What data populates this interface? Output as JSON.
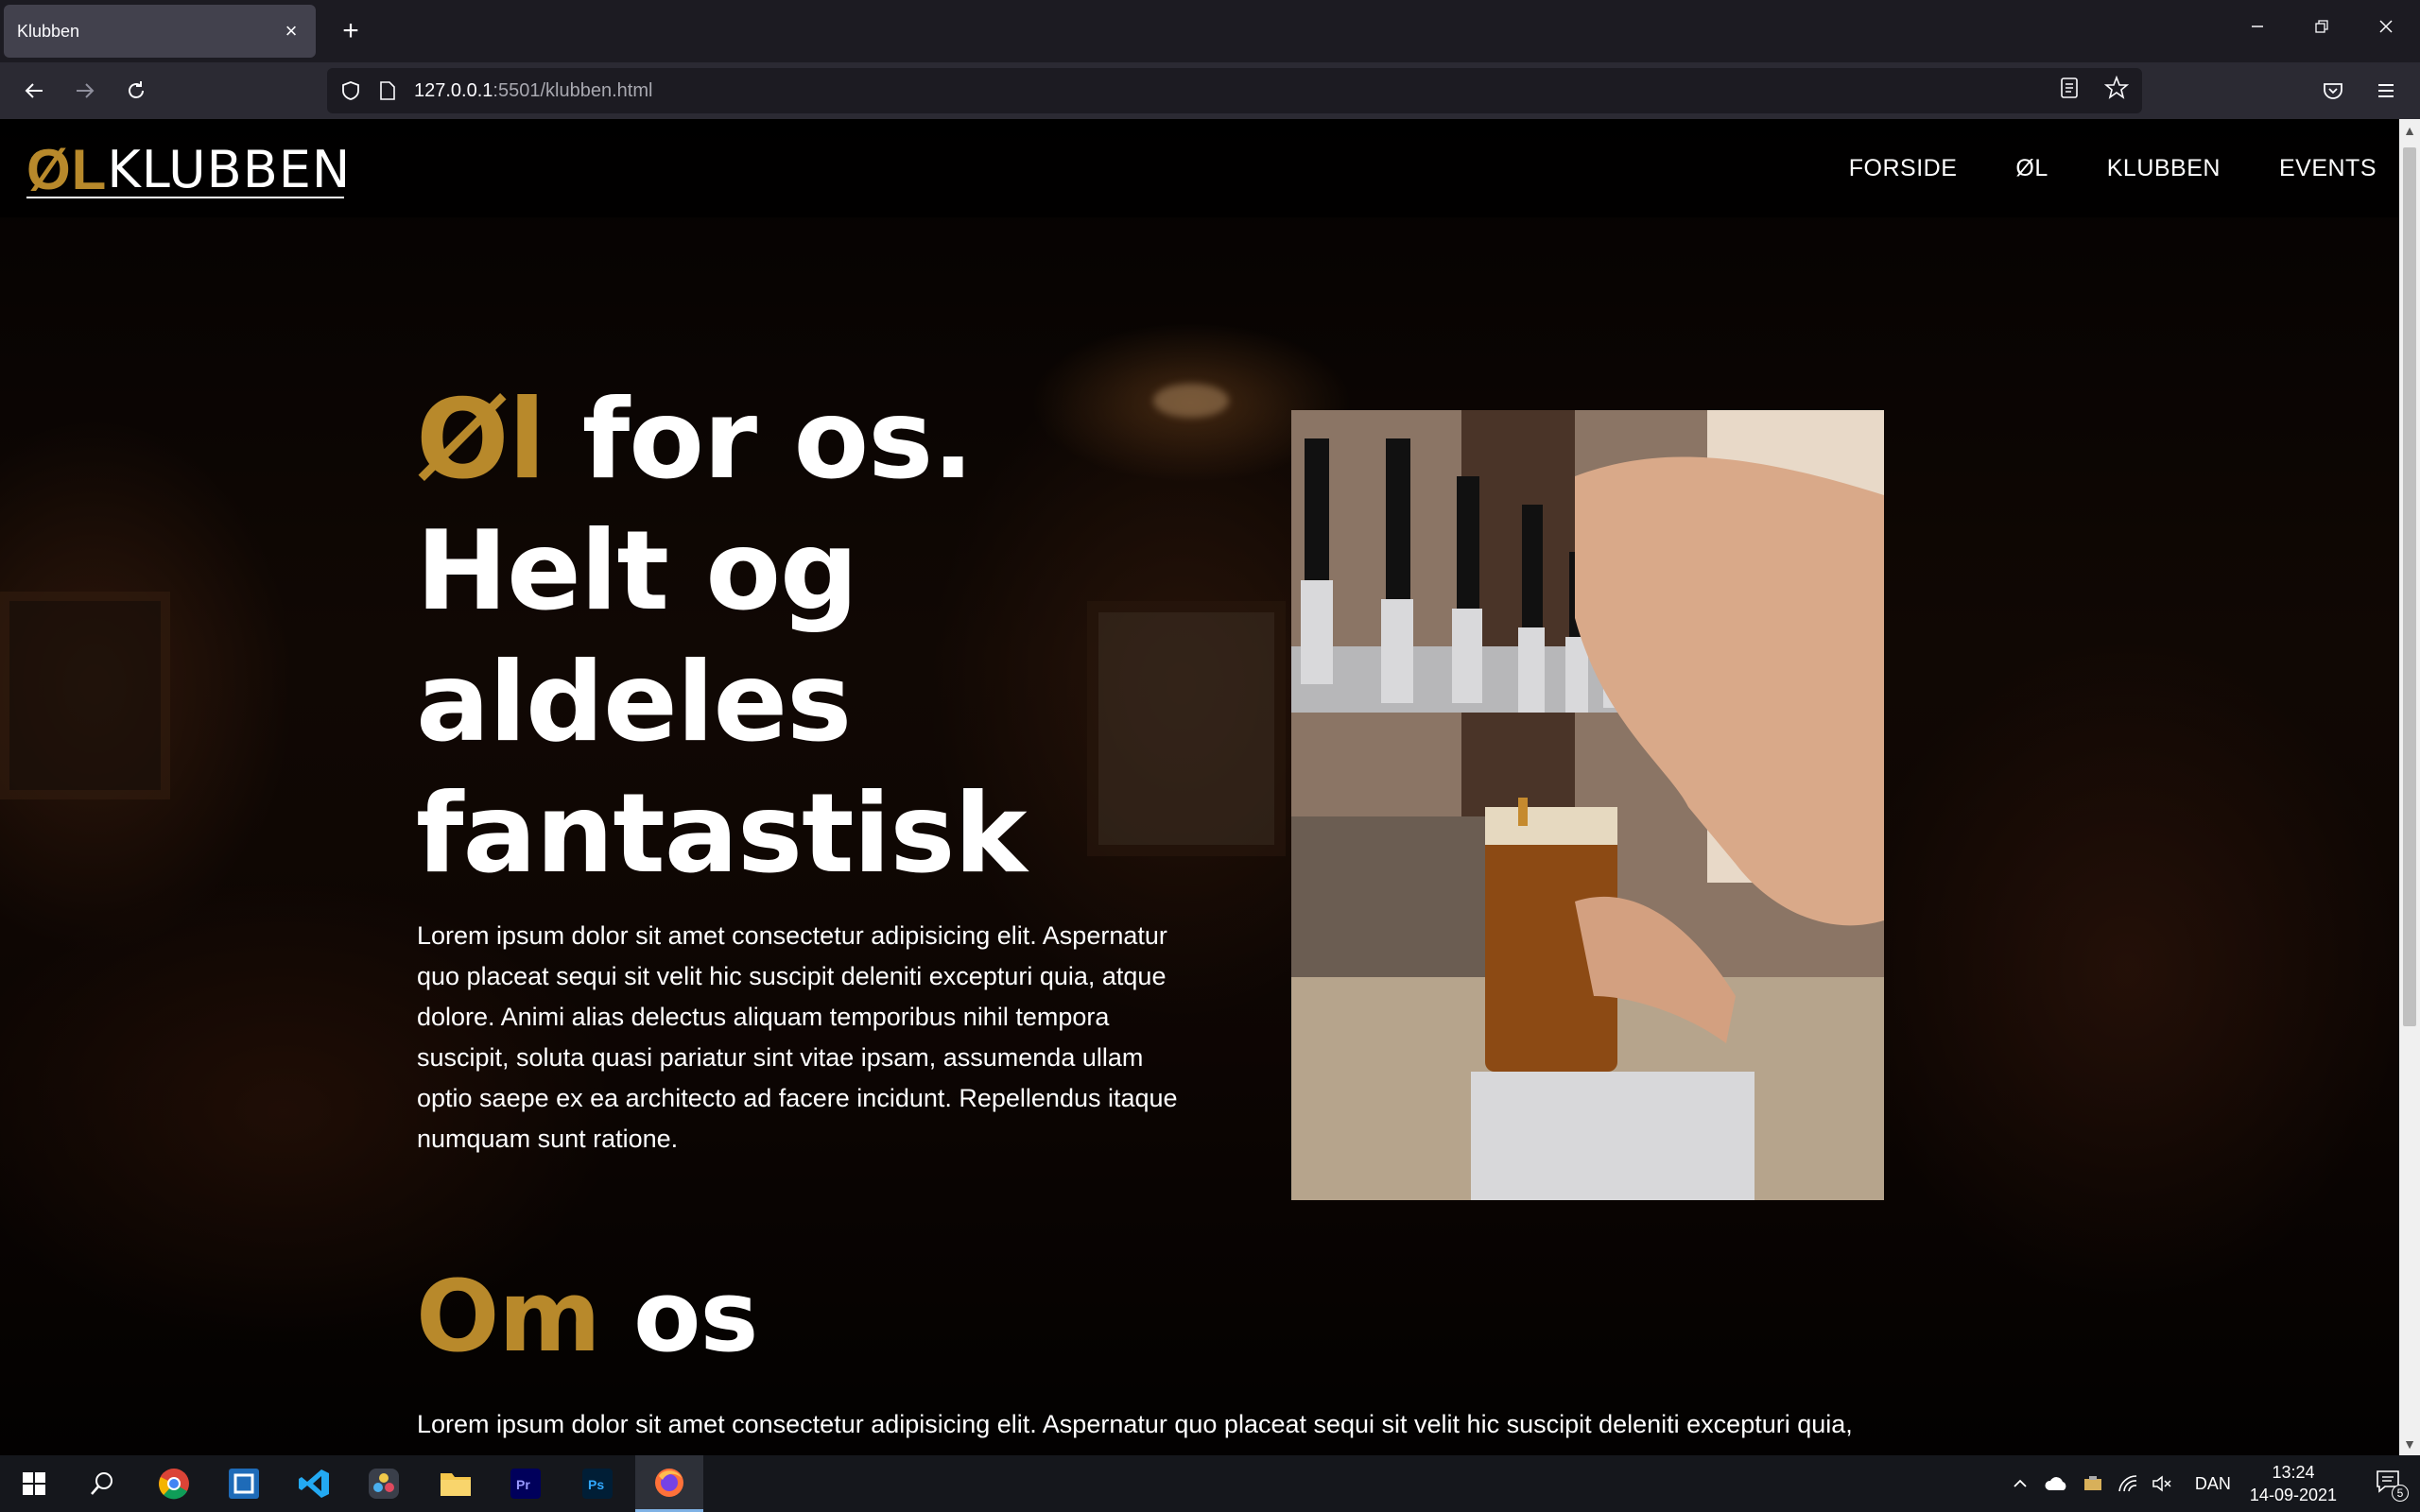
{
  "browser": {
    "tab_title": "Klubben",
    "url_host": "127.0.0.1",
    "url_path": ":5501/klubben.html"
  },
  "site": {
    "logo_ol": "ØL",
    "logo_rest": "KLUBBEN",
    "nav": [
      "FORSIDE",
      "ØL",
      "KLUBBEN",
      "EVENTS"
    ]
  },
  "hero": {
    "title_accent": "Øl",
    "title_line1_rest": " for os.",
    "title_line2": "Helt og",
    "title_line3": "aldeles",
    "title_line4": "fantastisk",
    "text": "Lorem ipsum dolor sit amet consectetur adipisicing elit. Aspernatur quo placeat sequi sit velit hic suscipit deleniti excepturi quia, atque dolore. Animi alias delectus aliquam temporibus nihil tempora suscipit, soluta quasi pariatur sint vitae ipsam, assumenda ullam optio saepe ex ea architecto ad facere incidunt. Repellendus itaque numquam sunt ratione."
  },
  "about": {
    "title_accent": "Om",
    "title_rest": " os",
    "text": "Lorem ipsum dolor sit amet consectetur adipisicing elit. Aspernatur quo placeat sequi sit velit hic suscipit deleniti excepturi quia,"
  },
  "taskbar": {
    "language": "DAN",
    "time": "13:24",
    "date": "14-09-2021",
    "notifications": "5"
  },
  "colors": {
    "accent": "#b8892b"
  }
}
